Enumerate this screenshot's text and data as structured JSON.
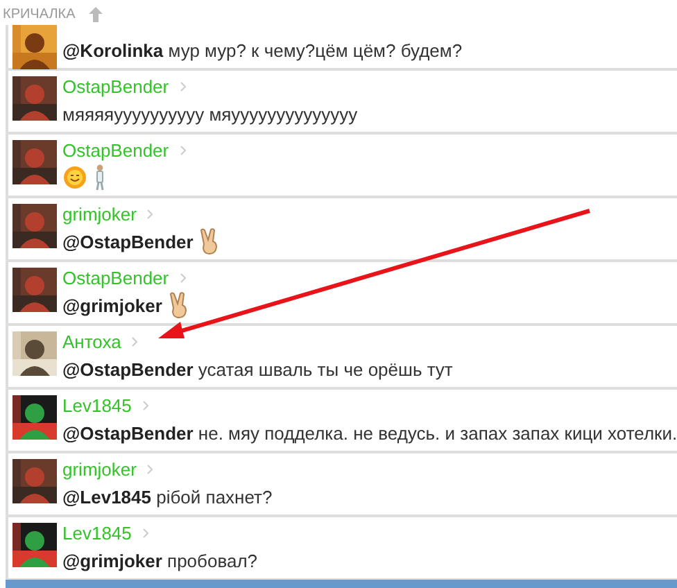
{
  "header": {
    "title": "КРИЧАЛКА"
  },
  "messages": [
    {
      "text": "**@Korolinka** мур мур? к чему?цём цём? будем?"
    },
    {
      "author": "OstapBender",
      "text": "мяяяяуууууууууу мяуууууууууууууу"
    },
    {
      "author": "OstapBender",
      "attachments": [
        {
          "kind": "sun"
        },
        {
          "kind": "figure"
        }
      ]
    },
    {
      "author": "grimjoker",
      "text": "**@OstapBender**",
      "attachments": [
        {
          "kind": "victory"
        }
      ]
    },
    {
      "author": "OstapBender",
      "text": "**@grimjoker**",
      "attachments": [
        {
          "kind": "victory"
        }
      ]
    },
    {
      "author": "Антоха",
      "text": "**@OstapBender** усатая шваль ты че орёшь тут"
    },
    {
      "author": "Lev1845",
      "text": "**@OstapBender** не. мяу подделка. не ведусь. и запах запах кици хотелки."
    },
    {
      "author": "grimjoker",
      "text": "**@Lev1845** рібой пахнет?"
    },
    {
      "author": "Lev1845",
      "text": "**@grimjoker** пробовал?"
    }
  ]
}
